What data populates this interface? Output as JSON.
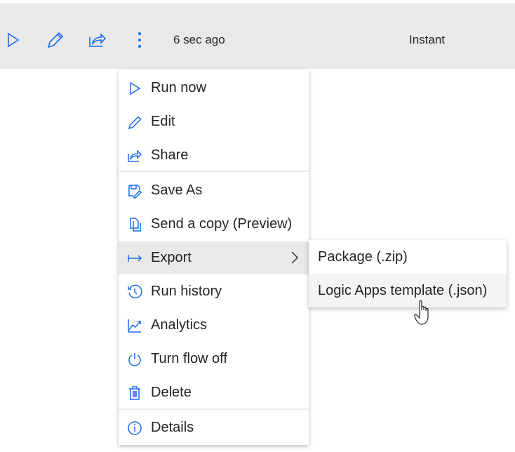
{
  "toolbar": {
    "last_run": "6 sec ago",
    "trigger_type": "Instant",
    "accent": "#1a6bef"
  },
  "menu": {
    "items": [
      {
        "label": "Run now",
        "icon": "play-icon"
      },
      {
        "label": "Edit",
        "icon": "pencil-icon"
      },
      {
        "label": "Share",
        "icon": "share-icon"
      },
      {
        "label": "Save As",
        "icon": "save-as-icon"
      },
      {
        "label": "Send a copy (Preview)",
        "icon": "copy-icon"
      },
      {
        "label": "Export",
        "icon": "export-arrow-icon"
      },
      {
        "label": "Run history",
        "icon": "history-icon"
      },
      {
        "label": "Analytics",
        "icon": "chart-icon"
      },
      {
        "label": "Turn flow off",
        "icon": "power-icon"
      },
      {
        "label": "Delete",
        "icon": "trash-icon"
      },
      {
        "label": "Details",
        "icon": "info-icon"
      }
    ]
  },
  "submenu": {
    "items": [
      {
        "label": "Package (.zip)"
      },
      {
        "label": "Logic Apps template (.json)"
      }
    ]
  }
}
